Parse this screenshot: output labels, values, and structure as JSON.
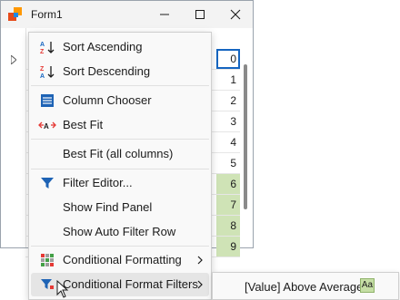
{
  "window": {
    "title": "Form1",
    "controls": {
      "minimize": "minimize",
      "maximize": "maximize",
      "close": "close"
    }
  },
  "grid": {
    "cells": [
      {
        "value": "0",
        "highlight": "focused"
      },
      {
        "value": "1",
        "highlight": "none"
      },
      {
        "value": "2",
        "highlight": "none"
      },
      {
        "value": "3",
        "highlight": "none"
      },
      {
        "value": "4",
        "highlight": "none"
      },
      {
        "value": "5",
        "highlight": "none"
      },
      {
        "value": "6",
        "highlight": "green"
      },
      {
        "value": "7",
        "highlight": "green"
      },
      {
        "value": "8",
        "highlight": "green"
      },
      {
        "value": "9",
        "highlight": "green"
      }
    ]
  },
  "context_menu": {
    "items": [
      {
        "label": "Sort Ascending",
        "icon": "sort-ascending-icon"
      },
      {
        "label": "Sort Descending",
        "icon": "sort-descending-icon"
      },
      {
        "label": "Column Chooser",
        "icon": "column-chooser-icon"
      },
      {
        "label": "Best Fit",
        "icon": "best-fit-icon"
      },
      {
        "label": "Best Fit (all columns)",
        "icon": ""
      },
      {
        "label": "Filter Editor...",
        "icon": "filter-icon"
      },
      {
        "label": "Show Find Panel",
        "icon": ""
      },
      {
        "label": "Show Auto Filter Row",
        "icon": ""
      },
      {
        "label": "Conditional Formatting",
        "icon": "conditional-formatting-icon",
        "submenu": true
      },
      {
        "label": "Conditional Format Filters",
        "icon": "conditional-format-filter-icon",
        "submenu": true,
        "hovered": true
      }
    ]
  },
  "submenu": {
    "item_label": "[Value] Above Average",
    "badge": "Aa"
  },
  "colors": {
    "accent": "#1565c0",
    "green_highlight": "#cfe3b6",
    "menu_background": "#f9f9f9"
  }
}
